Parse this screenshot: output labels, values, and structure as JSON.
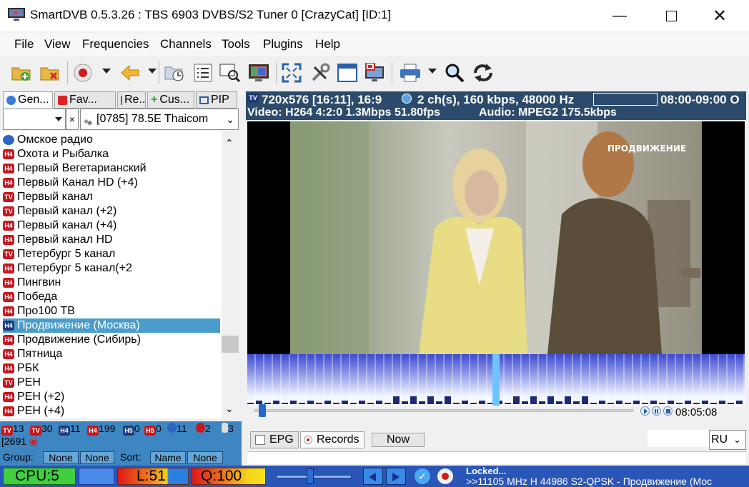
{
  "window": {
    "title": "SmartDVB 0.5.3.26 : TBS 6903 DVBS/S2 Tuner 0 [CrazyCat] [ID:1]",
    "controls": [
      "minimize",
      "maximize",
      "close"
    ]
  },
  "menu": [
    "File",
    "View",
    "Frequencies",
    "Channels",
    "Tools",
    "Plugins",
    "Help"
  ],
  "toolbar_icons": [
    "open-folder-icon",
    "delete-folder-icon",
    "record-icon",
    "back-arrow-icon",
    "scheduler-icon",
    "list-icon",
    "scan-icon",
    "tv-icon",
    "fullscreen-icon",
    "tools-icon",
    "window-icon",
    "stop-display-icon",
    "printer-icon",
    "search-icon",
    "refresh-icon"
  ],
  "left_tabs": [
    "Gen...",
    "Fav...",
    "Re...",
    "Cus...",
    "PIP"
  ],
  "satellite": {
    "filter_value": "",
    "clear_label": "×",
    "selected": "[0785] 78.5E  Thaicom"
  },
  "channels": [
    {
      "type": "radio",
      "badge": "",
      "name": "Омское радио"
    },
    {
      "type": "hd",
      "badge": "H4",
      "name": "Охота и Рыбалка"
    },
    {
      "type": "hd",
      "badge": "H4",
      "name": "Первый Вегетарианский"
    },
    {
      "type": "hd",
      "badge": "H4",
      "name": "Первый Канал HD (+4)"
    },
    {
      "type": "tv",
      "badge": "TV",
      "name": "Первый канал"
    },
    {
      "type": "tv",
      "badge": "TV",
      "name": "Первый канал (+2)"
    },
    {
      "type": "hd",
      "badge": "H4",
      "name": "Первый канал (+4)"
    },
    {
      "type": "hd",
      "badge": "H4",
      "name": "Первый канал HD"
    },
    {
      "type": "tv",
      "badge": "TV",
      "name": "Петербург 5 канал"
    },
    {
      "type": "hd",
      "badge": "H4",
      "name": "Петербург 5 канал(+2"
    },
    {
      "type": "hd",
      "badge": "H4",
      "name": "Пингвин"
    },
    {
      "type": "hd",
      "badge": "H4",
      "name": "Победа"
    },
    {
      "type": "hd",
      "badge": "H4",
      "name": "Про100 ТВ"
    },
    {
      "type": "hd-sel",
      "badge": "H4",
      "name": "Продвижение (Москва)",
      "selected": true
    },
    {
      "type": "hd",
      "badge": "H4",
      "name": "Продвижение (Сибирь)"
    },
    {
      "type": "hd",
      "badge": "H4",
      "name": "Пятница"
    },
    {
      "type": "hd",
      "badge": "H4",
      "name": "РБК"
    },
    {
      "type": "tv",
      "badge": "TV",
      "name": "РЕН"
    },
    {
      "type": "hd",
      "badge": "H4",
      "name": "РЕН (+2)"
    },
    {
      "type": "hd",
      "badge": "H4",
      "name": "РЕН (+4)"
    }
  ],
  "stats": {
    "counts": [
      {
        "badge": "TV",
        "value": "13"
      },
      {
        "badge": "TV",
        "value": "30"
      },
      {
        "badge": "H4",
        "value": "11"
      },
      {
        "badge": "H4",
        "value": "199"
      },
      {
        "badge": "H5",
        "value": "0"
      },
      {
        "badge": "H5",
        "value": "0"
      },
      {
        "badge": "",
        "value": "11"
      },
      {
        "badge": "",
        "value": "2"
      },
      {
        "badge": "",
        "value": "3"
      }
    ],
    "total": "[2691",
    "group_label": "Group:",
    "group_values": [
      "None",
      "None"
    ],
    "sort_label": "Sort:",
    "sort_values": [
      "Name",
      "None"
    ]
  },
  "info": {
    "badge": "TV",
    "resolution": "720x576 [16:11], 16:9",
    "audio_channels": "2 ch(s), 160 kbps, 48000 Hz",
    "time": "08:00-09:00 O",
    "video": "Video: H264 4:2:0 1.3Mbps 51.80fps",
    "audio": "Audio: MPEG2 175.5kbps"
  },
  "video_overlay_text": "ПРОДВИЖЕНИЕ",
  "playback": {
    "position_fraction": 0.02,
    "time": "08:05:08"
  },
  "epg_tabs": [
    "EPG",
    "Records"
  ],
  "epg_now_label": "Now",
  "language": "RU",
  "statusbar": {
    "cpu": "CPU:5",
    "level": "L:51",
    "quality": "Q:100",
    "volume_fraction": 0.45,
    "locked": "Locked...",
    "tuning": ">>11105 MHz H 44986 S2-QPSK - Продвижение (Мос"
  },
  "colors": {
    "accent": "#2a56b8",
    "selection": "#4a9ccc",
    "info_header": "#2c4a6c"
  }
}
